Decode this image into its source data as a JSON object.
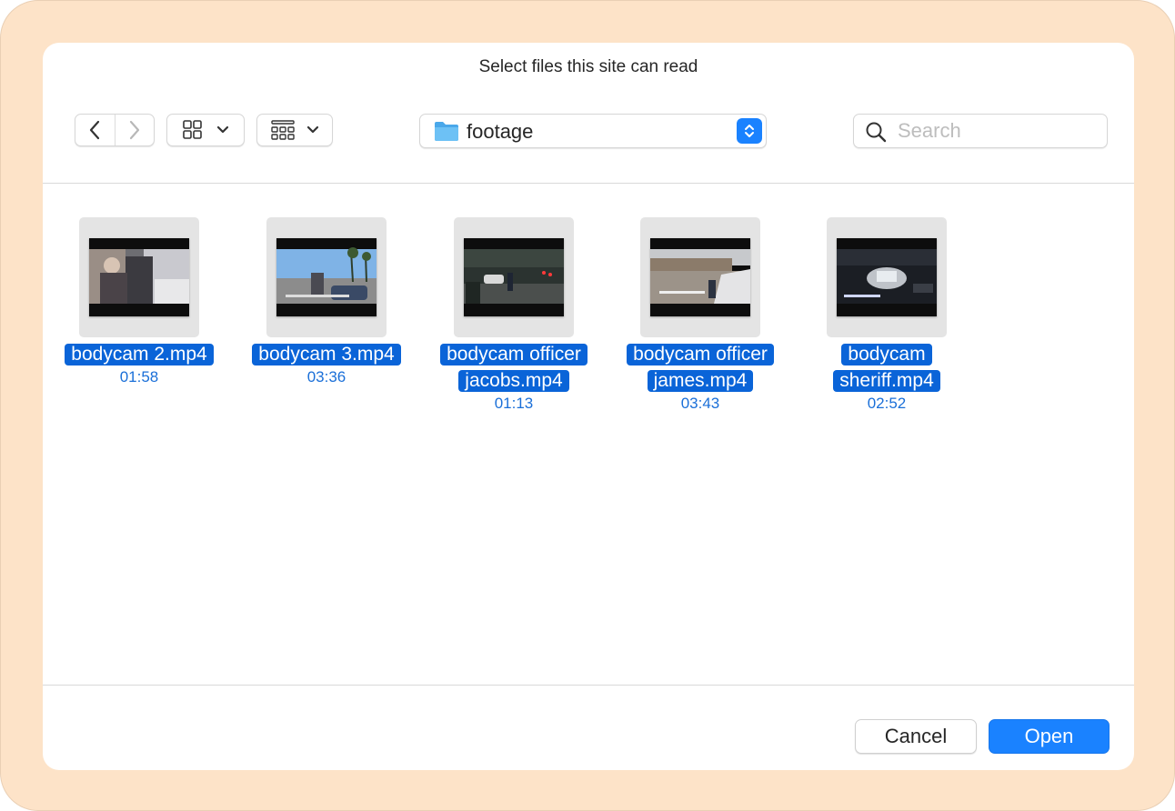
{
  "dialog": {
    "title": "Select files this site can read"
  },
  "toolbar": {
    "back_icon": "chevron-left-icon",
    "forward_icon": "chevron-right-icon",
    "view_icon": "grid-view-icon",
    "group_icon": "gallery-group-icon",
    "location": "footage",
    "location_icon": "folder-icon",
    "search": {
      "placeholder": "Search",
      "value": ""
    }
  },
  "files": [
    {
      "name": "bodycam 2.mp4",
      "duration": "01:58"
    },
    {
      "name": "bodycam 3.mp4",
      "duration": "03:36"
    },
    {
      "name": "bodycam officer jacobs.mp4",
      "duration": "01:13"
    },
    {
      "name": "bodycam officer james.mp4",
      "duration": "03:43"
    },
    {
      "name": "bodycam sheriff.mp4",
      "duration": "02:52"
    }
  ],
  "buttons": {
    "cancel": "Cancel",
    "open": "Open"
  },
  "colors": {
    "accent": "#1a82ff",
    "selection": "#0a64d8",
    "frame": "#fde3c8"
  }
}
